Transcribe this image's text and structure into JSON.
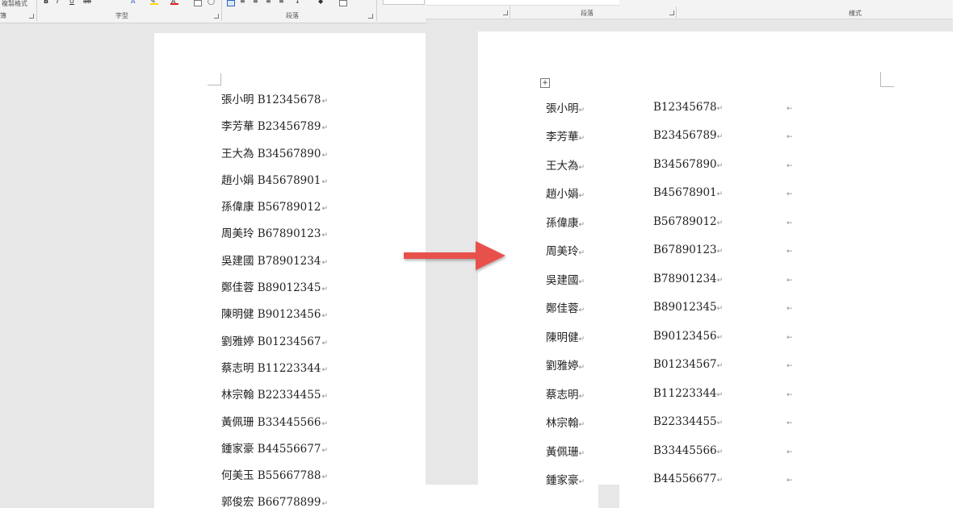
{
  "left_ribbon": {
    "copy_format_label": "複製格式",
    "clipboard_edge_label": "簿",
    "font_group_label": "字型",
    "paragraph_group_label": "段落",
    "icons": [
      "bold-icon",
      "italic-icon",
      "underline-icon",
      "strikethrough-icon",
      "text-effect-icon",
      "highlight-icon",
      "font-color-icon",
      "char-shading-icon",
      "enclose-char-icon",
      "align-left-icon",
      "align-center-icon",
      "align-right-icon",
      "justify-icon",
      "distributed-icon",
      "line-spacing-icon",
      "shading-icon",
      "borders-icon"
    ],
    "highlight_color": "#ffd700",
    "font_color": "#e31b1b"
  },
  "right_ribbon": {
    "paragraph_group_label": "段落",
    "styles_group_label": "樣式"
  },
  "paragraph_mark": "↵",
  "left_document": {
    "lines": [
      "張小明 B12345678",
      "李芳華 B23456789",
      "王大為 B34567890",
      "趙小娟 B45678901",
      "孫偉康 B56789012",
      "周美玲 B67890123",
      "吳建國 B78901234",
      "鄭佳蓉 B89012345",
      "陳明健 B90123456",
      "劉雅婷 B01234567",
      "蔡志明 B11223344",
      "林宗翰 B22334455",
      "黃佩珊 B33445566",
      "鍾家豪 B44556677",
      "何美玉 B55667788",
      "郭俊宏 B66778899"
    ]
  },
  "arrow": {
    "color": "#e8514b"
  },
  "right_document": {
    "table_move_icon": "+",
    "rows": [
      {
        "name": "張小明",
        "id": "B12345678"
      },
      {
        "name": "李芳華",
        "id": "B23456789"
      },
      {
        "name": "王大為",
        "id": "B34567890"
      },
      {
        "name": "趙小娟",
        "id": "B45678901"
      },
      {
        "name": "孫偉康",
        "id": "B56789012"
      },
      {
        "name": "周美玲",
        "id": "B67890123"
      },
      {
        "name": "吳建國",
        "id": "B78901234"
      },
      {
        "name": "鄭佳蓉",
        "id": "B89012345"
      },
      {
        "name": "陳明健",
        "id": "B90123456"
      },
      {
        "name": "劉雅婷",
        "id": "B01234567"
      },
      {
        "name": "蔡志明",
        "id": "B11223344"
      },
      {
        "name": "林宗翰",
        "id": "B22334455"
      },
      {
        "name": "黃佩珊",
        "id": "B33445566"
      },
      {
        "name": "鍾家豪",
        "id": "B44556677"
      }
    ],
    "row_end_mark": "←"
  }
}
